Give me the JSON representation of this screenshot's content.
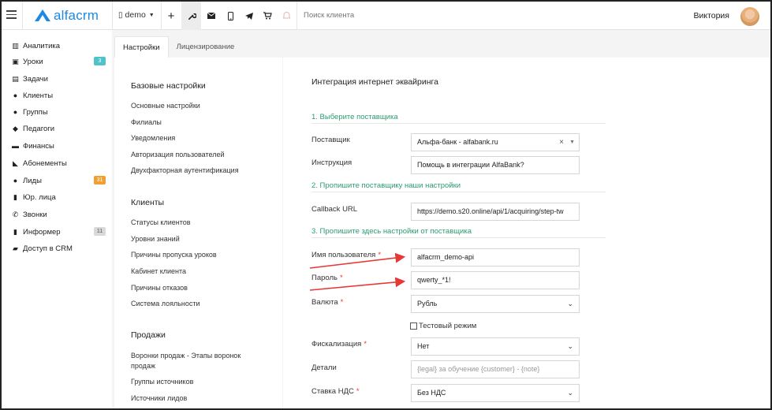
{
  "topbar": {
    "logo_text": "alfacrm",
    "account": "demo",
    "search_placeholder": "Поиск клиента",
    "user_name": "Виктория",
    "icons": [
      "plus-icon",
      "wrench-icon",
      "mail-icon",
      "phone-icon",
      "telegram-icon",
      "cart-icon",
      "bell-icon"
    ]
  },
  "sidebar": {
    "items": [
      {
        "label": "Аналитика",
        "icon": "columns-icon"
      },
      {
        "label": "Уроки",
        "icon": "calendar-icon",
        "badge": "3",
        "badge_color": "#4fc3c9"
      },
      {
        "label": "Задачи",
        "icon": "clipboard-icon"
      },
      {
        "label": "Клиенты",
        "icon": "user-icon"
      },
      {
        "label": "Группы",
        "icon": "users-icon"
      },
      {
        "label": "Педагоги",
        "icon": "graduation-cap-icon"
      },
      {
        "label": "Финансы",
        "icon": "money-icon"
      },
      {
        "label": "Абонементы",
        "icon": "tag-icon"
      },
      {
        "label": "Лиды",
        "icon": "user-plus-icon",
        "badge": "31",
        "badge_color": "#f0a030"
      },
      {
        "label": "Юр. лица",
        "icon": "briefcase-icon"
      },
      {
        "label": "Звонки",
        "icon": "phone-icon"
      },
      {
        "label": "Информер",
        "icon": "book-icon",
        "badge": "11",
        "badge_color": "#d9d9d9"
      },
      {
        "label": "Доступ в CRM",
        "icon": "lock-icon"
      }
    ]
  },
  "tabs": [
    {
      "label": "Настройки",
      "active": true
    },
    {
      "label": "Лицензирование",
      "active": false
    }
  ],
  "settings_nav": {
    "basic": {
      "title": "Базовые настройки",
      "links": [
        "Основные настройки",
        "Филиалы",
        "Уведомления",
        "Авторизация пользователей",
        "Двухфакторная аутентификация"
      ]
    },
    "clients": {
      "title": "Клиенты",
      "links": [
        "Статусы клиентов",
        "Уровни знаний",
        "Причины пропуска уроков",
        "Кабинет клиента",
        "Причины отказов",
        "Система лояльности"
      ]
    },
    "sales": {
      "title": "Продажи",
      "links": [
        "Воронки продаж - Этапы воронок продаж",
        "Группы источников",
        "Источники лидов"
      ]
    }
  },
  "form": {
    "title": "Интеграция интернет эквайринга",
    "section1": "1. Выберите поставщика",
    "section2": "2. Пропишите поставщику наши настройки",
    "section3": "3. Пропишите здесь настройки от поставщика",
    "provider_label": "Поставщик",
    "provider_value": "Альфа-банк - alfabank.ru",
    "instruction_label": "Инструкция",
    "instruction_value": "Помощь в интеграции AlfaBank?",
    "callback_label": "Callback URL",
    "callback_value": "https://demo.s20.online/api/1/acquiring/step-tw",
    "username_label": "Имя пользователя",
    "username_value": "alfacrm_demo-api",
    "password_label": "Пароль",
    "password_value": "qwerty_*1!",
    "currency_label": "Валюта",
    "currency_value": "Рубль",
    "test_mode_label": "Тестовый режим",
    "fiscal_label": "Фискализация",
    "fiscal_value": "Нет",
    "details_label": "Детали",
    "details_placeholder": "{legal} за обучение {customer} - {note}",
    "vat_label": "Ставка НДС",
    "vat_value": "Без НДС",
    "required_mark": "*"
  },
  "colors": {
    "brand": "#1e88e5",
    "section_green": "#2a9d6f",
    "required_red": "#e53935",
    "annotation_arrow": "#e53935"
  }
}
